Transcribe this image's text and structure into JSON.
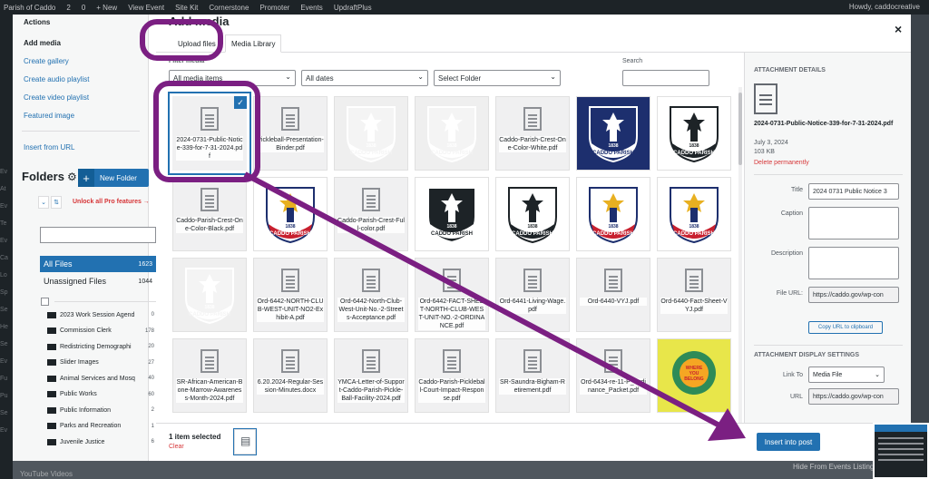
{
  "adminbar": {
    "items": [
      "Parish of Caddo",
      "2",
      "0",
      "+ New",
      "View Event",
      "Site Kit",
      "Cornerstone",
      "Promoter",
      "Events",
      "UpdraftPlus"
    ],
    "howdy": "Howdy, caddocreative"
  },
  "background": {
    "left_labels": [
      "Ev",
      "At",
      "Ev",
      "Te",
      "Ev",
      "Ca",
      "Lo",
      "Sp",
      "Se",
      "He",
      "Se",
      "Ev",
      "Fu",
      "Pu",
      "Se",
      "Ev"
    ],
    "bottom_left": "YouTube Videos",
    "bottom_right": "Hide From Events Listings"
  },
  "menu": {
    "actions": "Actions",
    "items": [
      "Add media",
      "Create gallery",
      "Create audio playlist",
      "Create video playlist",
      "Featured image"
    ],
    "insert_url": "Insert from URL"
  },
  "folders": {
    "title": "Folders",
    "new_folder": "New Folder",
    "unlock": "Unlock all Pro features →",
    "all_files": {
      "label": "All Files",
      "count": "1623"
    },
    "unassigned": {
      "label": "Unassigned Files",
      "count": "1044"
    },
    "tree": [
      {
        "name": "2023 Work Session Agend",
        "count": "0"
      },
      {
        "name": "Commission Clerk",
        "count": "178"
      },
      {
        "name": "Redistricting Demographi",
        "count": "20"
      },
      {
        "name": "Slider Images",
        "count": "27"
      },
      {
        "name": "Animal Services and Mosq",
        "count": "40"
      },
      {
        "name": "Public Works",
        "count": "60"
      },
      {
        "name": "Public Information",
        "count": "2"
      },
      {
        "name": "Parks and Recreation",
        "count": "1"
      },
      {
        "name": "Juvenile Justice",
        "count": "6"
      }
    ]
  },
  "modal": {
    "title": "Add media",
    "tabs": [
      "Upload files",
      "Media Library"
    ],
    "filter_label": "Filter media",
    "filter_type": "All media items",
    "filter_date": "All dates",
    "filter_folder": "Select Folder",
    "search_label": "Search"
  },
  "attachments": [
    {
      "name": "2024-0731-Public-Notice-339-for-7-31-2024.pdf",
      "kind": "doc",
      "selected": true
    },
    {
      "name": "Pickleball-Presentation-Binder.pdf",
      "kind": "doc"
    },
    {
      "name": "",
      "kind": "faint"
    },
    {
      "name": "",
      "kind": "faint"
    },
    {
      "name": "Caddo-Parish-Crest-One-Color-White.pdf",
      "kind": "doc"
    },
    {
      "name": "",
      "kind": "blue"
    },
    {
      "name": "",
      "kind": "wb"
    },
    {
      "name": "Caddo-Parish-Crest-One-Color-Black.pdf",
      "kind": "doc"
    },
    {
      "name": "",
      "kind": "color"
    },
    {
      "name": "Caddo-Parish-Crest-Full-color.pdf",
      "kind": "doc"
    },
    {
      "name": "",
      "kind": "bw"
    },
    {
      "name": "",
      "kind": "wb"
    },
    {
      "name": "",
      "kind": "color"
    },
    {
      "name": "",
      "kind": "color"
    },
    {
      "name": "",
      "kind": "faint"
    },
    {
      "name": "Ord-6442-NORTH-CLUB-WEST-UNIT-NO2-Exhibit-A.pdf",
      "kind": "doc"
    },
    {
      "name": "Ord-6442-North-Club-West-Unit-No.-2-Streets-Acceptance.pdf",
      "kind": "doc"
    },
    {
      "name": "Ord-6442-FACT-SHEET-NORTH-CLUB-WEST-UNIT-NO.-2-ORDINANCE.pdf",
      "kind": "doc"
    },
    {
      "name": "Ord-6441-Living-Wage.pdf",
      "kind": "doc"
    },
    {
      "name": "Ord-6440-VYJ.pdf",
      "kind": "doc"
    },
    {
      "name": "Ord-6440-Fact-Sheet-VYJ.pdf",
      "kind": "doc"
    },
    {
      "name": "SR-African-American-Bone-Marrow-Awareness-Month-2024.pdf",
      "kind": "doc"
    },
    {
      "name": "6.20.2024-Regular-Session-Minutes.docx",
      "kind": "doc"
    },
    {
      "name": "YMCA-Letter-of-Support-Caddo-Parish-Pickle-Ball-Facility-2024.pdf",
      "kind": "doc"
    },
    {
      "name": "Caddo-Parish-Pickleball-Court-Impact-Response.pdf",
      "kind": "doc"
    },
    {
      "name": "SR-Saundra-Bigham-Retirement.pdf",
      "kind": "doc"
    },
    {
      "name": "Ord-6434-re-11-P_Ordinance_Packet.pdf",
      "kind": "doc"
    },
    {
      "name": "",
      "kind": "yellow"
    }
  ],
  "seal_texts": {
    "caddo": "CADDO",
    "parish": "PARISH",
    "year": "1838"
  },
  "yellow_logo_text": "WHERE YOU BELONG",
  "toolbar": {
    "selected_count": "1 item selected",
    "clear": "Clear",
    "insert_button": "Insert into post"
  },
  "details": {
    "heading": "ATTACHMENT DETAILS",
    "filename": "2024-0731-Public-Notice-339-for-7-31-2024.pdf",
    "date": "July 3, 2024",
    "size": "103 KB",
    "delete": "Delete permanently",
    "title_label": "Title",
    "title_value": "2024 0731 Public Notice 3",
    "caption_label": "Caption",
    "description_label": "Description",
    "fileurl_label": "File URL:",
    "fileurl_value": "https://caddo.gov/wp-con",
    "copy_button": "Copy URL to clipboard",
    "display_heading": "ATTACHMENT DISPLAY SETTINGS",
    "linkto_label": "Link To",
    "linkto_value": "Media File",
    "url_label": "URL",
    "url_value": "https://caddo.gov/wp-con"
  },
  "colors": {
    "wp_blue": "#2271b1",
    "annotation_purple": "#7b1f82",
    "seal_navy": "#1d2f6e",
    "seal_red": "#c8202f",
    "seal_gold": "#e8b021"
  }
}
